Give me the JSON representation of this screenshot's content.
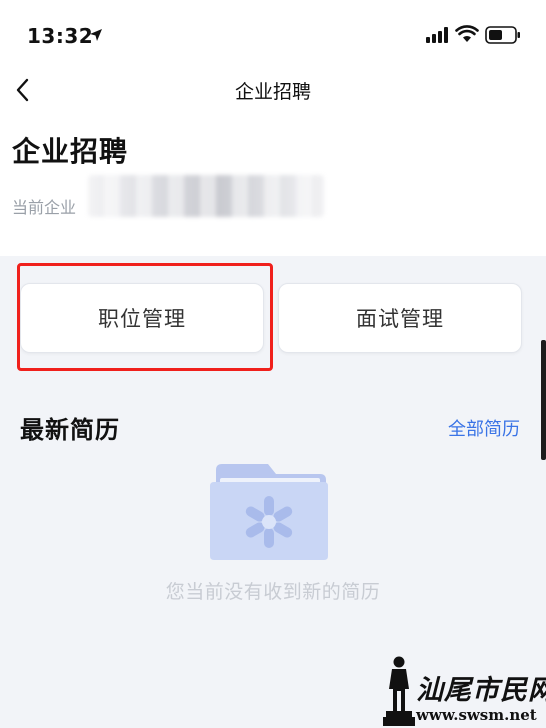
{
  "status_bar": {
    "time": "13:32",
    "icons": [
      "location-arrow-icon",
      "signal-icon",
      "wifi-icon",
      "battery-icon"
    ]
  },
  "nav": {
    "title": "企业招聘",
    "back_icon": "chevron-left-icon"
  },
  "header": {
    "title": "企业招聘",
    "company_prefix": "当前企业"
  },
  "actions": [
    {
      "label": "职位管理",
      "highlighted": true
    },
    {
      "label": "面试管理",
      "highlighted": false
    }
  ],
  "resumes": {
    "title": "最新简历",
    "link_label": "全部简历",
    "empty_icon": "empty-folder-icon",
    "empty_text": "您当前没有收到新的简历"
  },
  "watermark": {
    "name": "汕尾市民网",
    "url": "www.swsm.net"
  },
  "colors": {
    "accent": "#3a74e6",
    "highlight_box": "#f0201c",
    "page_background": "#f2f4f8",
    "header_background": "#ffffff"
  }
}
